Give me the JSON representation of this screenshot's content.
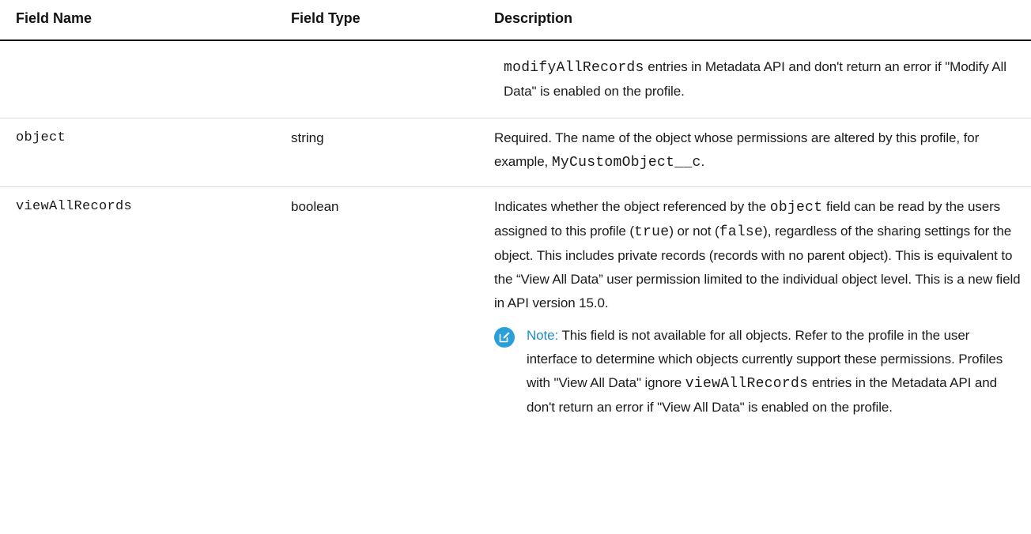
{
  "table": {
    "headers": {
      "field_name": "Field Name",
      "field_type": "Field Type",
      "description": "Description"
    },
    "rows": [
      {
        "field_name": "",
        "field_type": "",
        "description": {
          "code1": "modifyAllRecords",
          "text1": " entries in Metadata API and don't return an error if \"Modify All Data\" is enabled on the profile."
        }
      },
      {
        "field_name": "object",
        "field_type": "string",
        "description": {
          "text1": "Required. The name of the object whose permissions are altered by this profile, for example, ",
          "code1": "MyCustomObject__c",
          "text2": "."
        }
      },
      {
        "field_name": "viewAllRecords",
        "field_type": "boolean",
        "description": {
          "text1": "Indicates whether the object referenced by the ",
          "code1": "object",
          "text2": " field can be read by the users assigned to this profile (",
          "code2": "true",
          "text3": ") or not (",
          "code3": "false",
          "text4": "), regardless of the sharing settings for the object. This includes private records (records with no parent object). This is equivalent to the “View All Data” user permission limited to the individual object level. This is a new field in API version 15.0."
        },
        "note": {
          "icon": "edit-note-icon",
          "label": "Note:",
          "text1": " This field is not available for all objects. Refer to the profile in the user interface to determine which objects currently support these permissions. Profiles with \"View All Data\" ignore ",
          "code1": "viewAllRecords",
          "text2": " entries in the Metadata API and don't return an error if \"View All Data\" is enabled on the profile."
        }
      }
    ]
  },
  "colors": {
    "note_icon_bg": "#2b9fd9",
    "note_label": "#1d8ac8"
  }
}
